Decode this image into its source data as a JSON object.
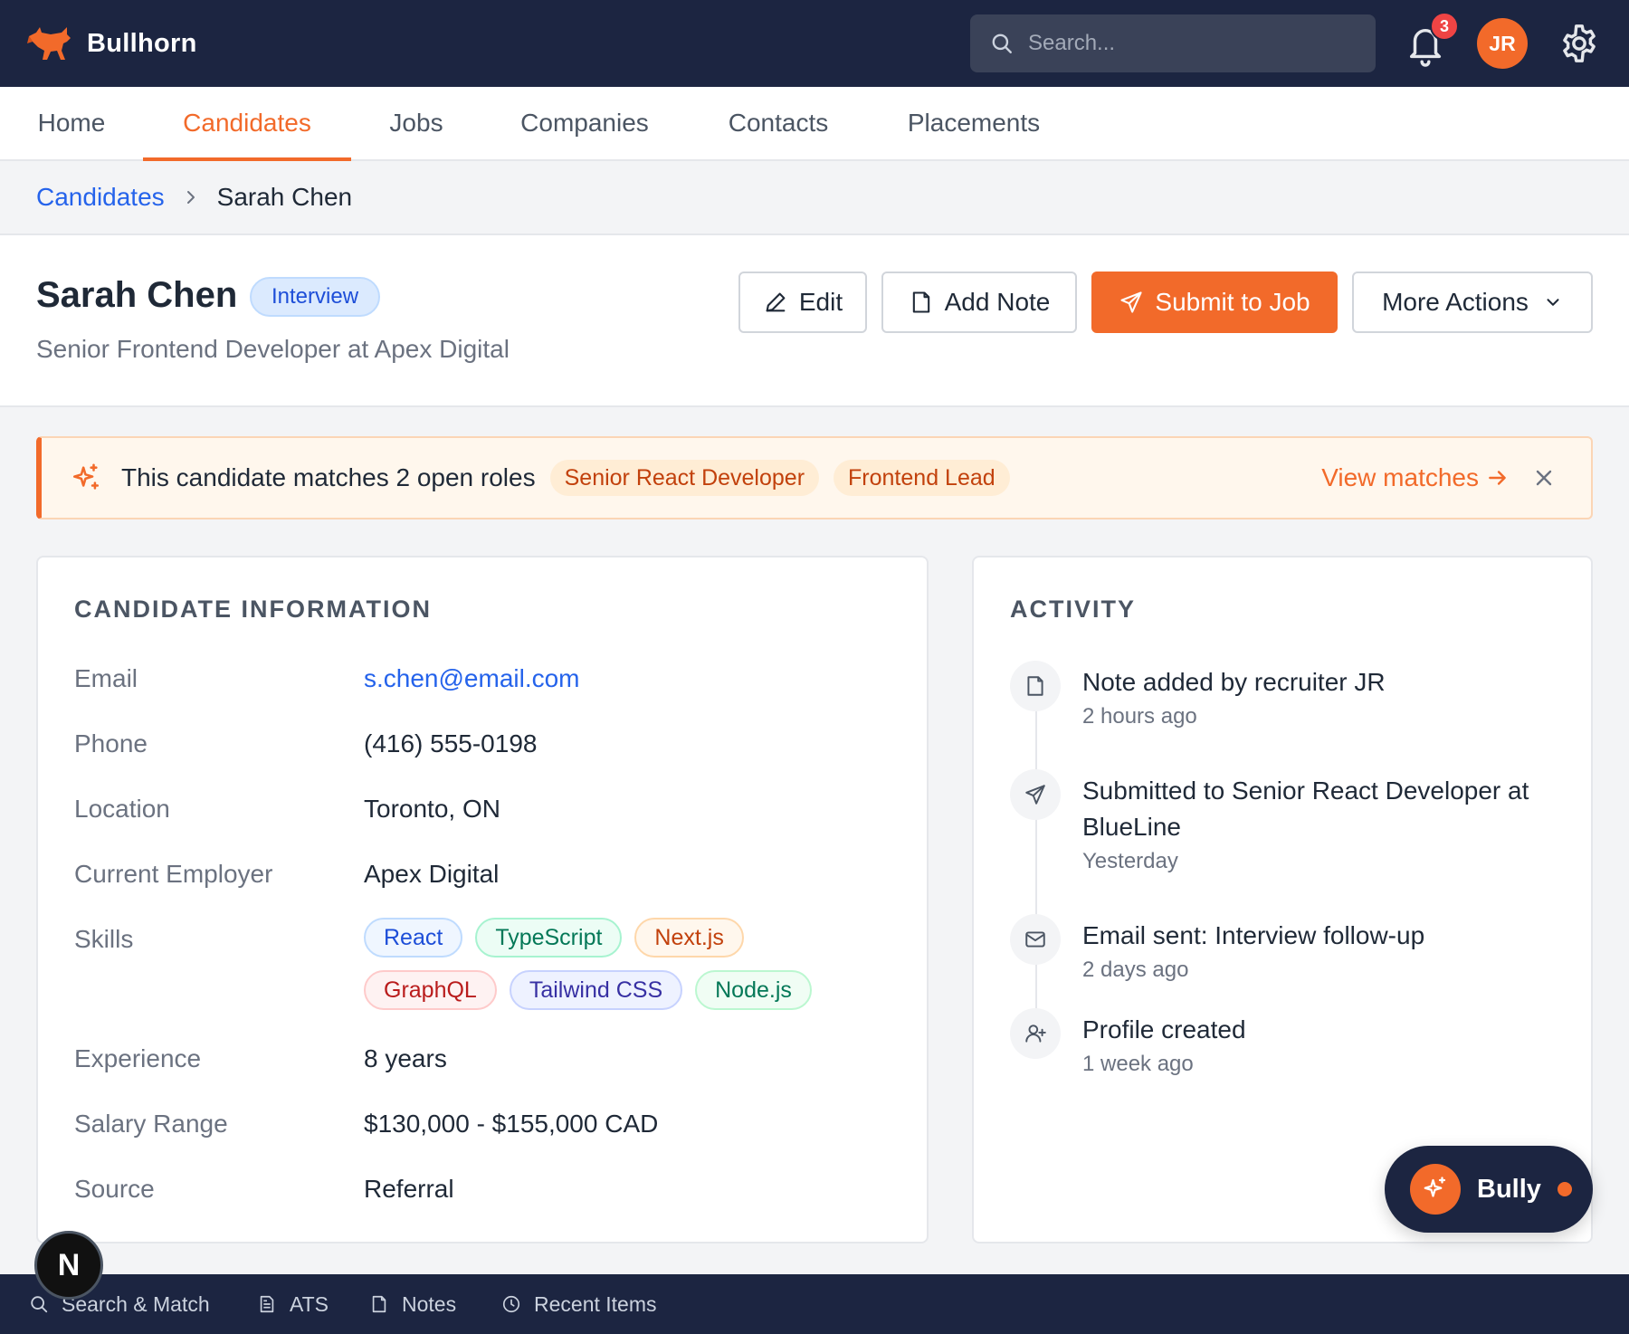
{
  "app": {
    "name": "Bullhorn"
  },
  "search": {
    "placeholder": "Search..."
  },
  "notifications": {
    "count": "3"
  },
  "user": {
    "initials": "JR"
  },
  "nav": {
    "tabs": [
      {
        "label": "Home",
        "active": false
      },
      {
        "label": "Candidates",
        "active": true
      },
      {
        "label": "Jobs",
        "active": false
      },
      {
        "label": "Companies",
        "active": false
      },
      {
        "label": "Contacts",
        "active": false
      },
      {
        "label": "Placements",
        "active": false
      }
    ]
  },
  "breadcrumb": {
    "parent": "Candidates",
    "separator": "›",
    "current": "Sarah Chen"
  },
  "candidate": {
    "name": "Sarah Chen",
    "status": "Interview",
    "title": "Senior Frontend Developer at Apex Digital"
  },
  "actions": {
    "edit": "Edit",
    "add_note": "Add Note",
    "submit": "Submit to Job",
    "more": "More Actions"
  },
  "banner": {
    "text": "This candidate matches 2 open roles",
    "roles": [
      "Senior React Developer",
      "Frontend Lead"
    ],
    "link": "View matches"
  },
  "info": {
    "title": "CANDIDATE INFORMATION",
    "email_label": "Email",
    "email": "s.chen@email.com",
    "phone_label": "Phone",
    "phone": "(416) 555-0198",
    "location_label": "Location",
    "location": "Toronto, ON",
    "employer_label": "Current Employer",
    "employer": "Apex Digital",
    "skills_label": "Skills",
    "skills": [
      "React",
      "TypeScript",
      "Next.js",
      "GraphQL",
      "Tailwind CSS",
      "Node.js"
    ],
    "experience_label": "Experience",
    "experience": "8 years",
    "salary_label": "Salary Range",
    "salary": "$130,000 - $155,000 CAD",
    "source_label": "Source",
    "source": "Referral"
  },
  "activity": {
    "title": "ACTIVITY",
    "items": [
      {
        "icon": "note-icon",
        "text": "Note added by recruiter JR",
        "time": "2 hours ago"
      },
      {
        "icon": "send-icon",
        "text": "Submitted to Senior React Developer at BlueLine",
        "time": "Yesterday"
      },
      {
        "icon": "mail-icon",
        "text": "Email sent: Interview follow-up",
        "time": "2 days ago"
      },
      {
        "icon": "user-plus-icon",
        "text": "Profile created",
        "time": "1 week ago"
      }
    ]
  },
  "assistant": {
    "label": "Bully"
  },
  "bottom_bar": {
    "items": [
      "Search & Match",
      "ATS",
      "Notes",
      "Recent Items"
    ]
  },
  "dev_badge": {
    "letter": "N"
  },
  "colors": {
    "brand": "#f26a2a",
    "navy": "#1c2541",
    "link": "#2563eb"
  }
}
